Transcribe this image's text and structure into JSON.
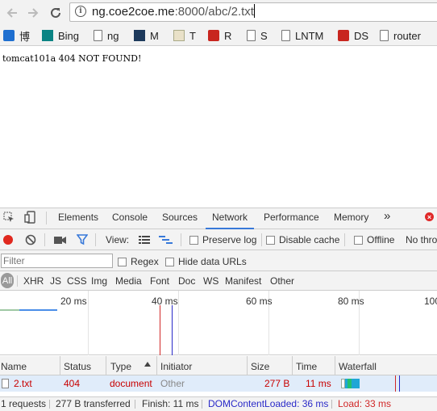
{
  "browser": {
    "url_host": "ng.coe2coe.me",
    "url_rest": ":8000/abc/2.txt",
    "bookmarks": [
      {
        "label": "博",
        "icon": "blog-icon"
      },
      {
        "label": "Bing",
        "icon": "bing-icon"
      },
      {
        "label": "ng",
        "icon": "page-icon"
      },
      {
        "label": "M",
        "icon": "m-icon"
      },
      {
        "label": "T",
        "icon": "chart-icon"
      },
      {
        "label": "R",
        "icon": "redis-icon"
      },
      {
        "label": "S",
        "icon": "page-icon"
      },
      {
        "label": "LNTM",
        "icon": "page-icon"
      },
      {
        "label": "DS",
        "icon": "ds-icon"
      },
      {
        "label": "router",
        "icon": "page-icon"
      }
    ]
  },
  "page": {
    "message": "tomcat101a 404 NOT FOUND!"
  },
  "devtools": {
    "tabs": [
      "Elements",
      "Console",
      "Sources",
      "Network",
      "Performance",
      "Memory"
    ],
    "active_tab": "Network",
    "more": "»",
    "toolbar": {
      "view_label": "View:",
      "preserve_log": "Preserve log",
      "disable_cache": "Disable cache",
      "offline": "Offline",
      "throttle": "No thro"
    },
    "filter": {
      "placeholder": "Filter",
      "regex": "Regex",
      "hide_data_urls": "Hide data URLs"
    },
    "types": [
      "All",
      "XHR",
      "JS",
      "CSS",
      "Img",
      "Media",
      "Font",
      "Doc",
      "WS",
      "Manifest",
      "Other"
    ],
    "overview_ticks": [
      "20 ms",
      "40 ms",
      "60 ms",
      "80 ms",
      "100"
    ],
    "columns": [
      "Name",
      "Status",
      "Type",
      "Initiator",
      "Size",
      "Time",
      "Waterfall"
    ],
    "rows": [
      {
        "name": "2.txt",
        "status": "404",
        "type": "document",
        "initiator": "Other",
        "size": "277 B",
        "time": "11 ms"
      }
    ],
    "status_bar": {
      "requests": "1 requests",
      "transferred": "277 B transferred",
      "finish": "Finish: 11 ms",
      "dcl": "DOMContentLoaded: 36 ms",
      "load": "Load: 33 ms"
    },
    "colors": {
      "accent": "#3879d9",
      "error": "#c80000",
      "dcl": "#2a2ac8",
      "load": "#d12828"
    }
  }
}
